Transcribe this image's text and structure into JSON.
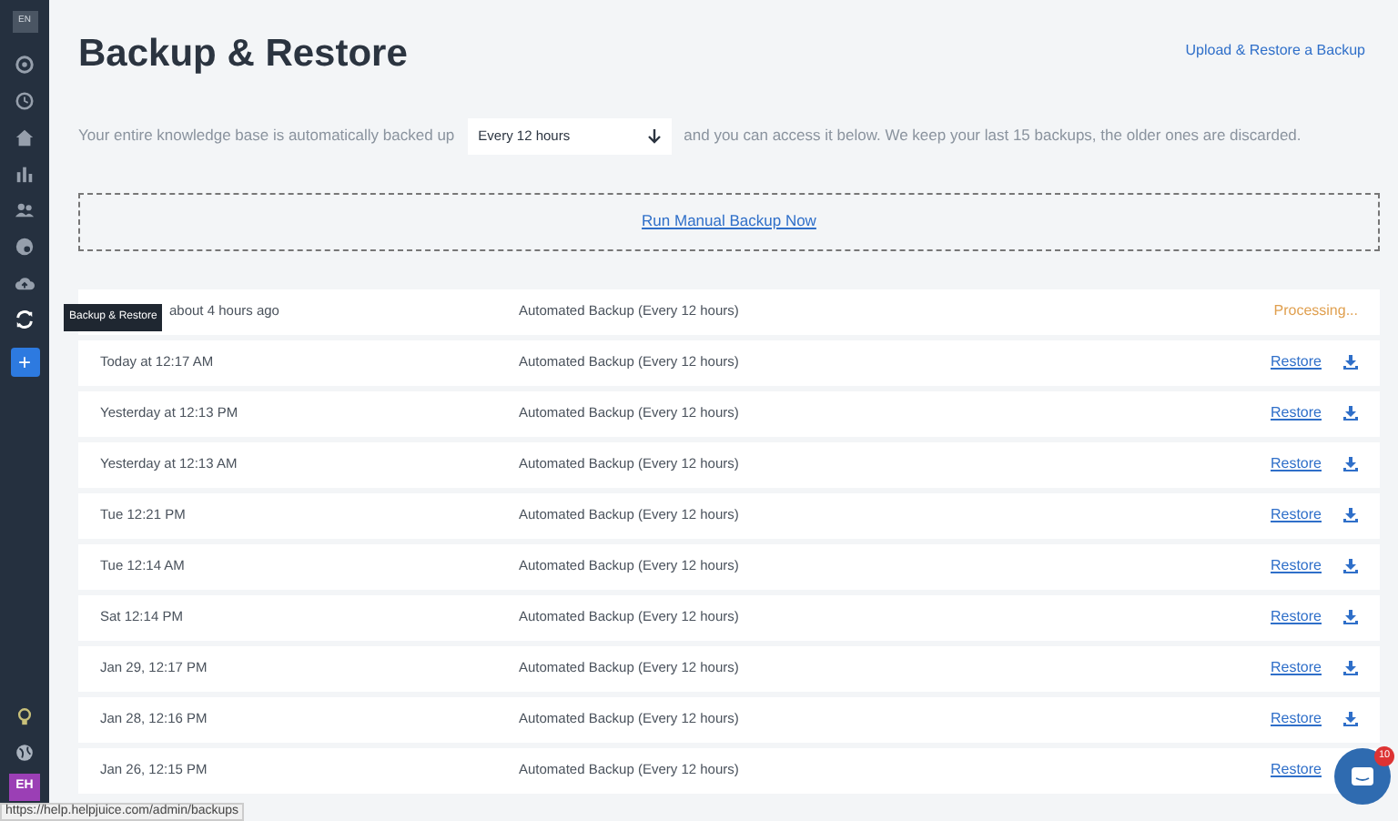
{
  "sidebar": {
    "language": "EN",
    "items": [
      {
        "selected": false
      },
      {
        "selected": false
      },
      {
        "selected": false
      },
      {
        "selected": false
      },
      {
        "selected": false
      },
      {
        "selected": false
      },
      {
        "selected": false
      },
      {
        "selected": true,
        "tooltip": "Backup & Restore"
      }
    ],
    "add_button": "+",
    "avatar": "EH"
  },
  "title": "Backup & Restore",
  "top_link": "Upload & Restore a Backup",
  "description_before": "Your entire knowledge base is automatically backed up",
  "frequency": "Every 12 hours",
  "description_after": "and you can access it below. We keep your last 15 backups, the older ones are discarded.",
  "manual_backup": "Run Manual Backup Now",
  "backups": [
    {
      "date": "about 4 hours ago",
      "type": "Automated Backup (Every 12 hours)",
      "kind": "processing",
      "status_text": "Processing..."
    },
    {
      "date": "Today at 12:17 AM",
      "type": "Automated Backup (Every 12 hours)",
      "kind": "restore",
      "status_text": "Restore"
    },
    {
      "date": "Yesterday at 12:13 PM",
      "type": "Automated Backup (Every 12 hours)",
      "kind": "restore",
      "status_text": "Restore"
    },
    {
      "date": "Yesterday at 12:13 AM",
      "type": "Automated Backup (Every 12 hours)",
      "kind": "restore",
      "status_text": "Restore"
    },
    {
      "date": "Tue 12:21 PM",
      "type": "Automated Backup (Every 12 hours)",
      "kind": "restore",
      "status_text": "Restore"
    },
    {
      "date": "Tue 12:14 AM",
      "type": "Automated Backup (Every 12 hours)",
      "kind": "restore",
      "status_text": "Restore"
    },
    {
      "date": "Sat 12:14 PM",
      "type": "Automated Backup (Every 12 hours)",
      "kind": "restore",
      "status_text": "Restore"
    },
    {
      "date": "Jan 29, 12:17 PM",
      "type": "Automated Backup (Every 12 hours)",
      "kind": "restore",
      "status_text": "Restore"
    },
    {
      "date": "Jan 28, 12:16 PM",
      "type": "Automated Backup (Every 12 hours)",
      "kind": "restore",
      "status_text": "Restore"
    },
    {
      "date": "Jan 26, 12:15 PM",
      "type": "Automated Backup (Every 12 hours)",
      "kind": "restore_link_only",
      "status_text": "Restore"
    }
  ],
  "chat_badge": "10",
  "status_bar": "https://help.helpjuice.com/admin/backups"
}
